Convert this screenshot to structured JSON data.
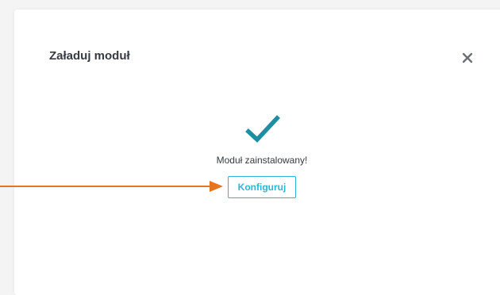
{
  "modal": {
    "title": "Załaduj moduł",
    "close_icon": "close-icon",
    "success_icon": "checkmark-icon",
    "status_text": "Moduł zainstalowany!",
    "configure_label": "Konfiguruj"
  },
  "colors": {
    "accent": "#25b9d7",
    "check": "#1e8ea3",
    "annotation_arrow": "#e8731d",
    "title": "#363a41"
  }
}
